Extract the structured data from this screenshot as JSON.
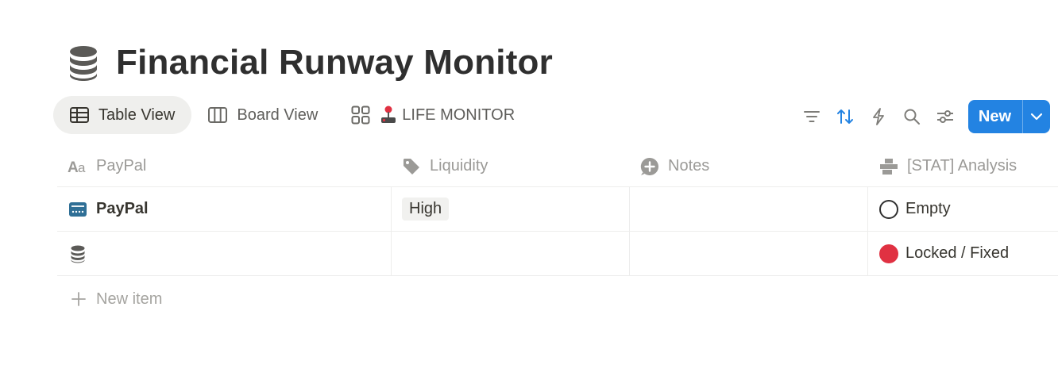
{
  "page": {
    "icon": "database-icon",
    "title": "Financial Runway Monitor"
  },
  "tabs": [
    {
      "label": "Table View",
      "icon": "table-icon",
      "active": true
    },
    {
      "label": "Board View",
      "icon": "board-icon",
      "active": false
    },
    {
      "label": "LIFE MONITOR",
      "icon": "gallery-icon",
      "emoji": "joystick-icon",
      "active": false
    }
  ],
  "toolbar": {
    "tools": [
      "filter-icon",
      "sort-icon",
      "automation-icon",
      "search-icon",
      "settings-icon"
    ],
    "new_label": "New"
  },
  "table": {
    "columns": [
      {
        "label": "PayPal",
        "icon": "text-icon"
      },
      {
        "label": "Liquidity",
        "icon": "tag-icon"
      },
      {
        "label": "Notes",
        "icon": "comment-plus-icon"
      },
      {
        "label": "[STAT] Analysis",
        "icon": "formula-icon"
      }
    ],
    "rows": [
      {
        "name": "PayPal",
        "icon": "card-icon",
        "liquidity": "High",
        "notes": "",
        "stat": "Empty",
        "stat_color": "#ffffff"
      },
      {
        "name": "",
        "icon": "database-icon",
        "liquidity": "",
        "notes": "",
        "stat": "Locked / Fixed",
        "stat_color": "#e03142"
      }
    ],
    "new_item_label": "New item"
  },
  "colors": {
    "accent": "#2383e2",
    "status_red": "#e03142",
    "tag_bg": "#f1f1ef"
  }
}
